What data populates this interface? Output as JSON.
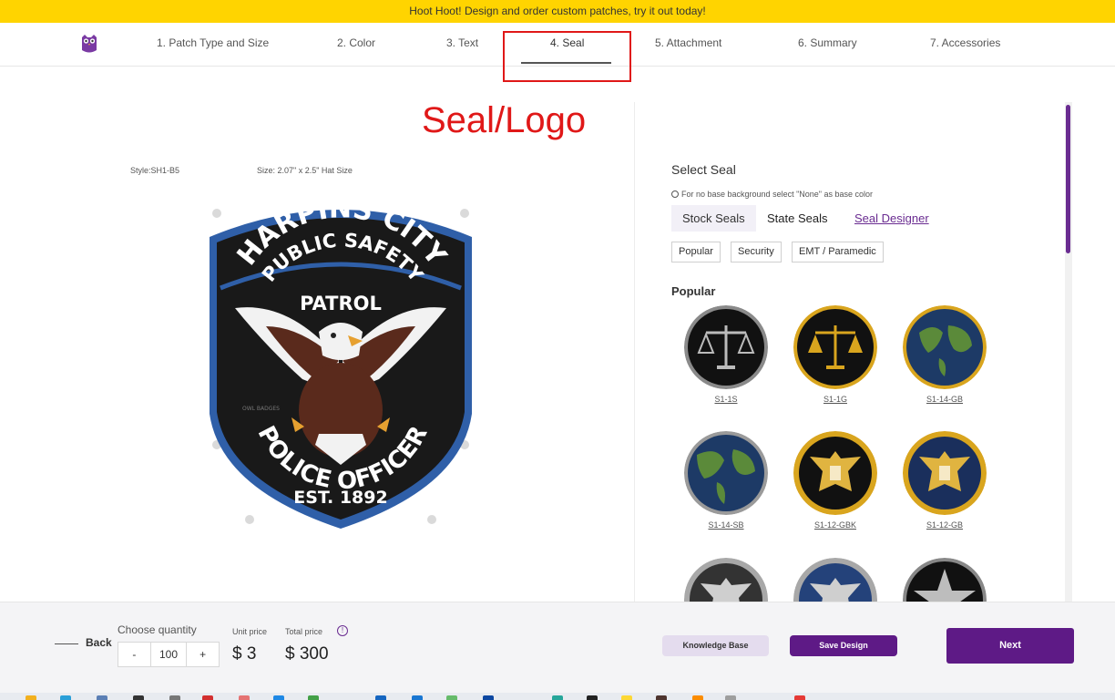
{
  "banner": {
    "text": "Hoot Hoot! Design and order custom patches, try it out today!"
  },
  "nav": {
    "steps": [
      {
        "label": "1. Patch Type and Size"
      },
      {
        "label": "2. Color"
      },
      {
        "label": "3. Text"
      },
      {
        "label": "4. Seal",
        "active": true
      },
      {
        "label": "5. Attachment"
      },
      {
        "label": "6. Summary"
      },
      {
        "label": "7. Accessories"
      }
    ]
  },
  "annotation": {
    "text": "Seal/Logo",
    "color": "#e01818"
  },
  "preview": {
    "style": "Style:SH1-B5",
    "size": "Size: 2.07\" x 2.5\" Hat Size",
    "patch": {
      "top_text": "HARPINS CITY",
      "middle_line1": "PUBLIC SAFETY",
      "middle_line2": "PATROL",
      "bottom_text": "POLICE OFFICER",
      "est": "EST. 1892",
      "watermark": "OWL BADGES"
    }
  },
  "panel": {
    "title": "Select Seal",
    "hint": "For no base background select \"None\" as base color",
    "tabs": [
      {
        "label": "Stock Seals",
        "active": true
      },
      {
        "label": "State Seals"
      },
      {
        "label": "Seal Designer",
        "link": true
      }
    ],
    "chips": [
      "Popular",
      "Security",
      "EMT / Paramedic"
    ],
    "section_title": "Popular",
    "seals": [
      {
        "code": "S1-1S",
        "icon": "scales-silver"
      },
      {
        "code": "S1-1G",
        "icon": "scales-gold"
      },
      {
        "code": "S1-14-GB",
        "icon": "globe-gold-ring"
      },
      {
        "code": "S1-14-SB",
        "icon": "globe-silver-ring"
      },
      {
        "code": "S1-12-GBK",
        "icon": "eagle-gold-black"
      },
      {
        "code": "S1-12-GB",
        "icon": "eagle-gold-blue"
      },
      {
        "code": "",
        "icon": "eagle-silver"
      },
      {
        "code": "",
        "icon": "eagle-blue"
      },
      {
        "code": "",
        "icon": "star-black"
      }
    ]
  },
  "footer": {
    "back_label": "Back",
    "qty_label": "Choose quantity",
    "qty_minus": "-",
    "qty_value": "100",
    "qty_plus": "+",
    "unit_price_label": "Unit price",
    "unit_price": "$ 3",
    "total_price_label": "Total price",
    "total_price": "$ 300",
    "info_glyph": "!",
    "knowledge_base": "Knowledge Base",
    "save_design": "Save Design",
    "next": "Next"
  },
  "colors": {
    "accent": "#5e1a86",
    "banner": "#ffd400"
  }
}
